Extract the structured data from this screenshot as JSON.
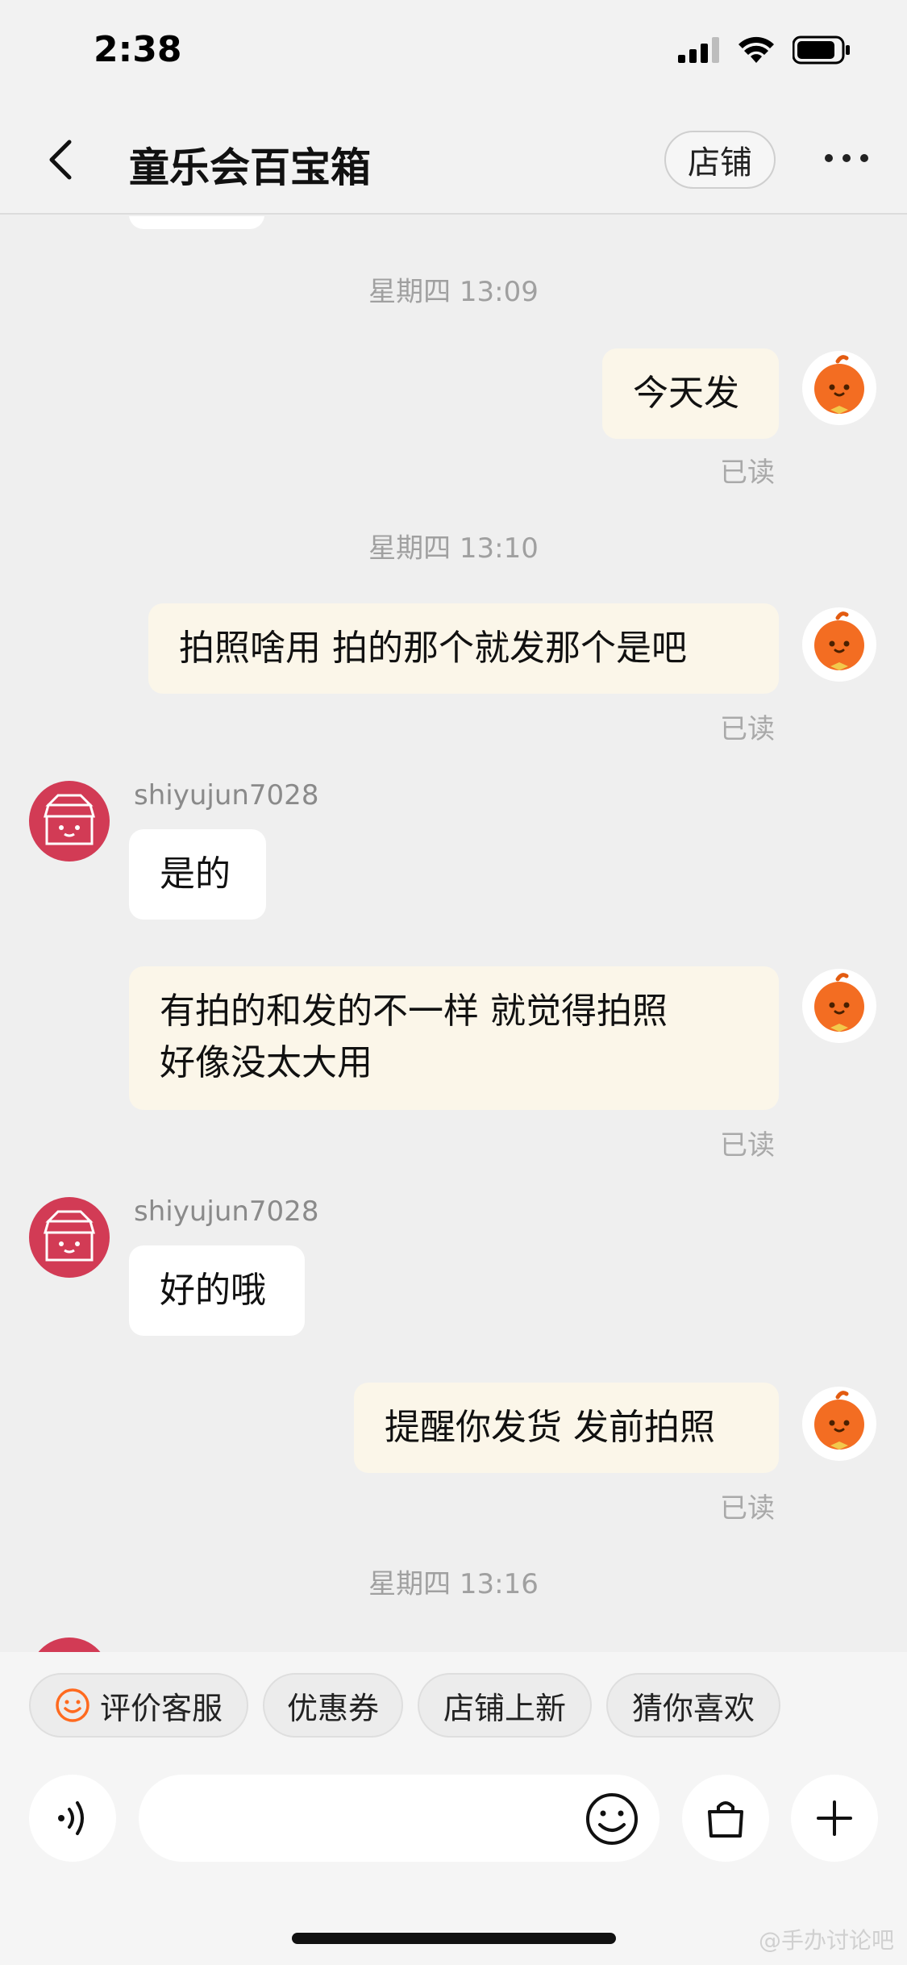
{
  "status_bar": {
    "time": "2:38"
  },
  "nav": {
    "title": "童乐会百宝箱",
    "shop_label": "店铺"
  },
  "messages": {
    "ts1": "星期四 13:09",
    "m1": "今天发",
    "ts2": "星期四 13:10",
    "m2": "拍照啥用  拍的那个就发那个是吧",
    "user1": "shiyujun7028",
    "m3": "是的",
    "m4_line1": "有拍的和发的不一样 就觉得拍照",
    "m4_line2": "好像没太大用",
    "user2": "shiyujun7028",
    "m5": "好的哦",
    "m6": "提醒你发货 发前拍照",
    "ts3": "星期四 13:16",
    "read_label": "已读"
  },
  "quick_actions": [
    "评价客服",
    "优惠券",
    "店铺上新",
    "猜你喜欢"
  ],
  "input": {
    "placeholder": ""
  },
  "watermark": "@手办讨论吧",
  "colors": {
    "bubble_out": "#fbf6e9",
    "bubble_in": "#ffffff",
    "accent": "#ff6a1f",
    "shop_avatar": "#d23b55"
  }
}
